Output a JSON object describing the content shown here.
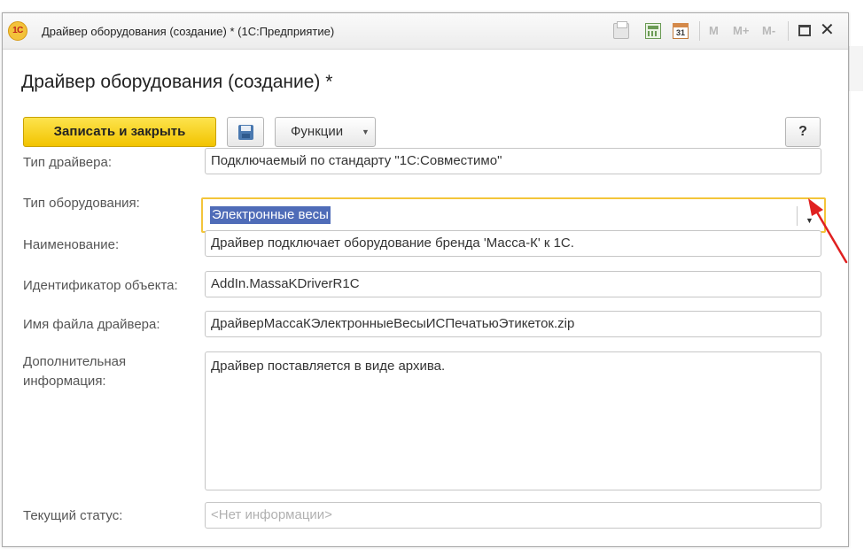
{
  "window": {
    "title": "Драйвер оборудования (создание) * (1С:Предприятие)",
    "logo_text": "1С",
    "calendar_day": "31",
    "memory_buttons": [
      "M",
      "M+",
      "M-"
    ]
  },
  "form": {
    "title": "Драйвер оборудования (создание) *"
  },
  "toolbar": {
    "save_close_label": "Записать и закрыть",
    "functions_label": "Функции",
    "help_label": "?"
  },
  "fields": {
    "driver_type": {
      "label": "Тип драйвера:",
      "value": "Подключаемый по стандарту \"1С:Совместимо\""
    },
    "equipment_type": {
      "label": "Тип оборудования:",
      "value": "Электронные весы"
    },
    "name": {
      "label": "Наименование:",
      "value": "Драйвер подключает оборудование бренда 'Масса-К' к 1С."
    },
    "object_id": {
      "label": "Идентификатор объекта:",
      "value": "AddIn.MassaKDriverR1C"
    },
    "file_name": {
      "label": "Имя файла драйвера:",
      "value": "ДрайверМассаКЭлектронныеВесыИСПечатьюЭтикеток.zip"
    },
    "extra_info": {
      "label": "Дополнительная информация:",
      "value": "Драйвер поставляется в виде архива."
    },
    "status": {
      "label": "Текущий статус:",
      "placeholder": "<Нет информации>"
    }
  },
  "colors": {
    "primary_button": "#f7d31e",
    "focus_border": "#f3c53a",
    "selection": "#4f6cb8",
    "annotation_arrow": "#e02020"
  }
}
